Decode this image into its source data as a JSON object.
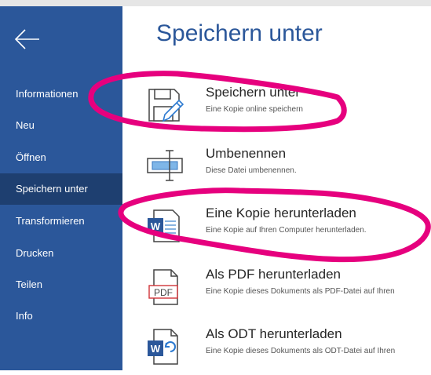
{
  "sidebar": {
    "items": [
      {
        "label": "Informationen"
      },
      {
        "label": "Neu"
      },
      {
        "label": "Öffnen"
      },
      {
        "label": "Speichern unter"
      },
      {
        "label": "Transformieren"
      },
      {
        "label": "Drucken"
      },
      {
        "label": "Teilen"
      },
      {
        "label": "Info"
      }
    ],
    "active_index": 3,
    "back_icon": "back-arrow-icon"
  },
  "main": {
    "title": "Speichern unter",
    "options": [
      {
        "title": "Speichern unter",
        "desc": "Eine Kopie online speichern",
        "icon": "save-as-icon"
      },
      {
        "title": "Umbenennen",
        "desc": "Diese Datei umbenennen.",
        "icon": "rename-icon"
      },
      {
        "title": "Eine Kopie herunterladen",
        "desc": "Eine Kopie auf Ihren Computer herunterladen.",
        "icon": "word-download-icon"
      },
      {
        "title": "Als PDF herunterladen",
        "desc": "Eine Kopie dieses Dokuments als PDF-Datei auf Ihren",
        "icon": "pdf-icon",
        "icon_text": "PDF"
      },
      {
        "title": "Als ODT herunterladen",
        "desc": "Eine Kopie dieses Dokuments als ODT-Datei auf Ihren",
        "icon": "odt-icon"
      }
    ]
  },
  "colors": {
    "sidebar": "#2b579a",
    "sidebar_active": "#1e3f70",
    "accent": "#2b579a",
    "annotation": "#e6007e"
  }
}
